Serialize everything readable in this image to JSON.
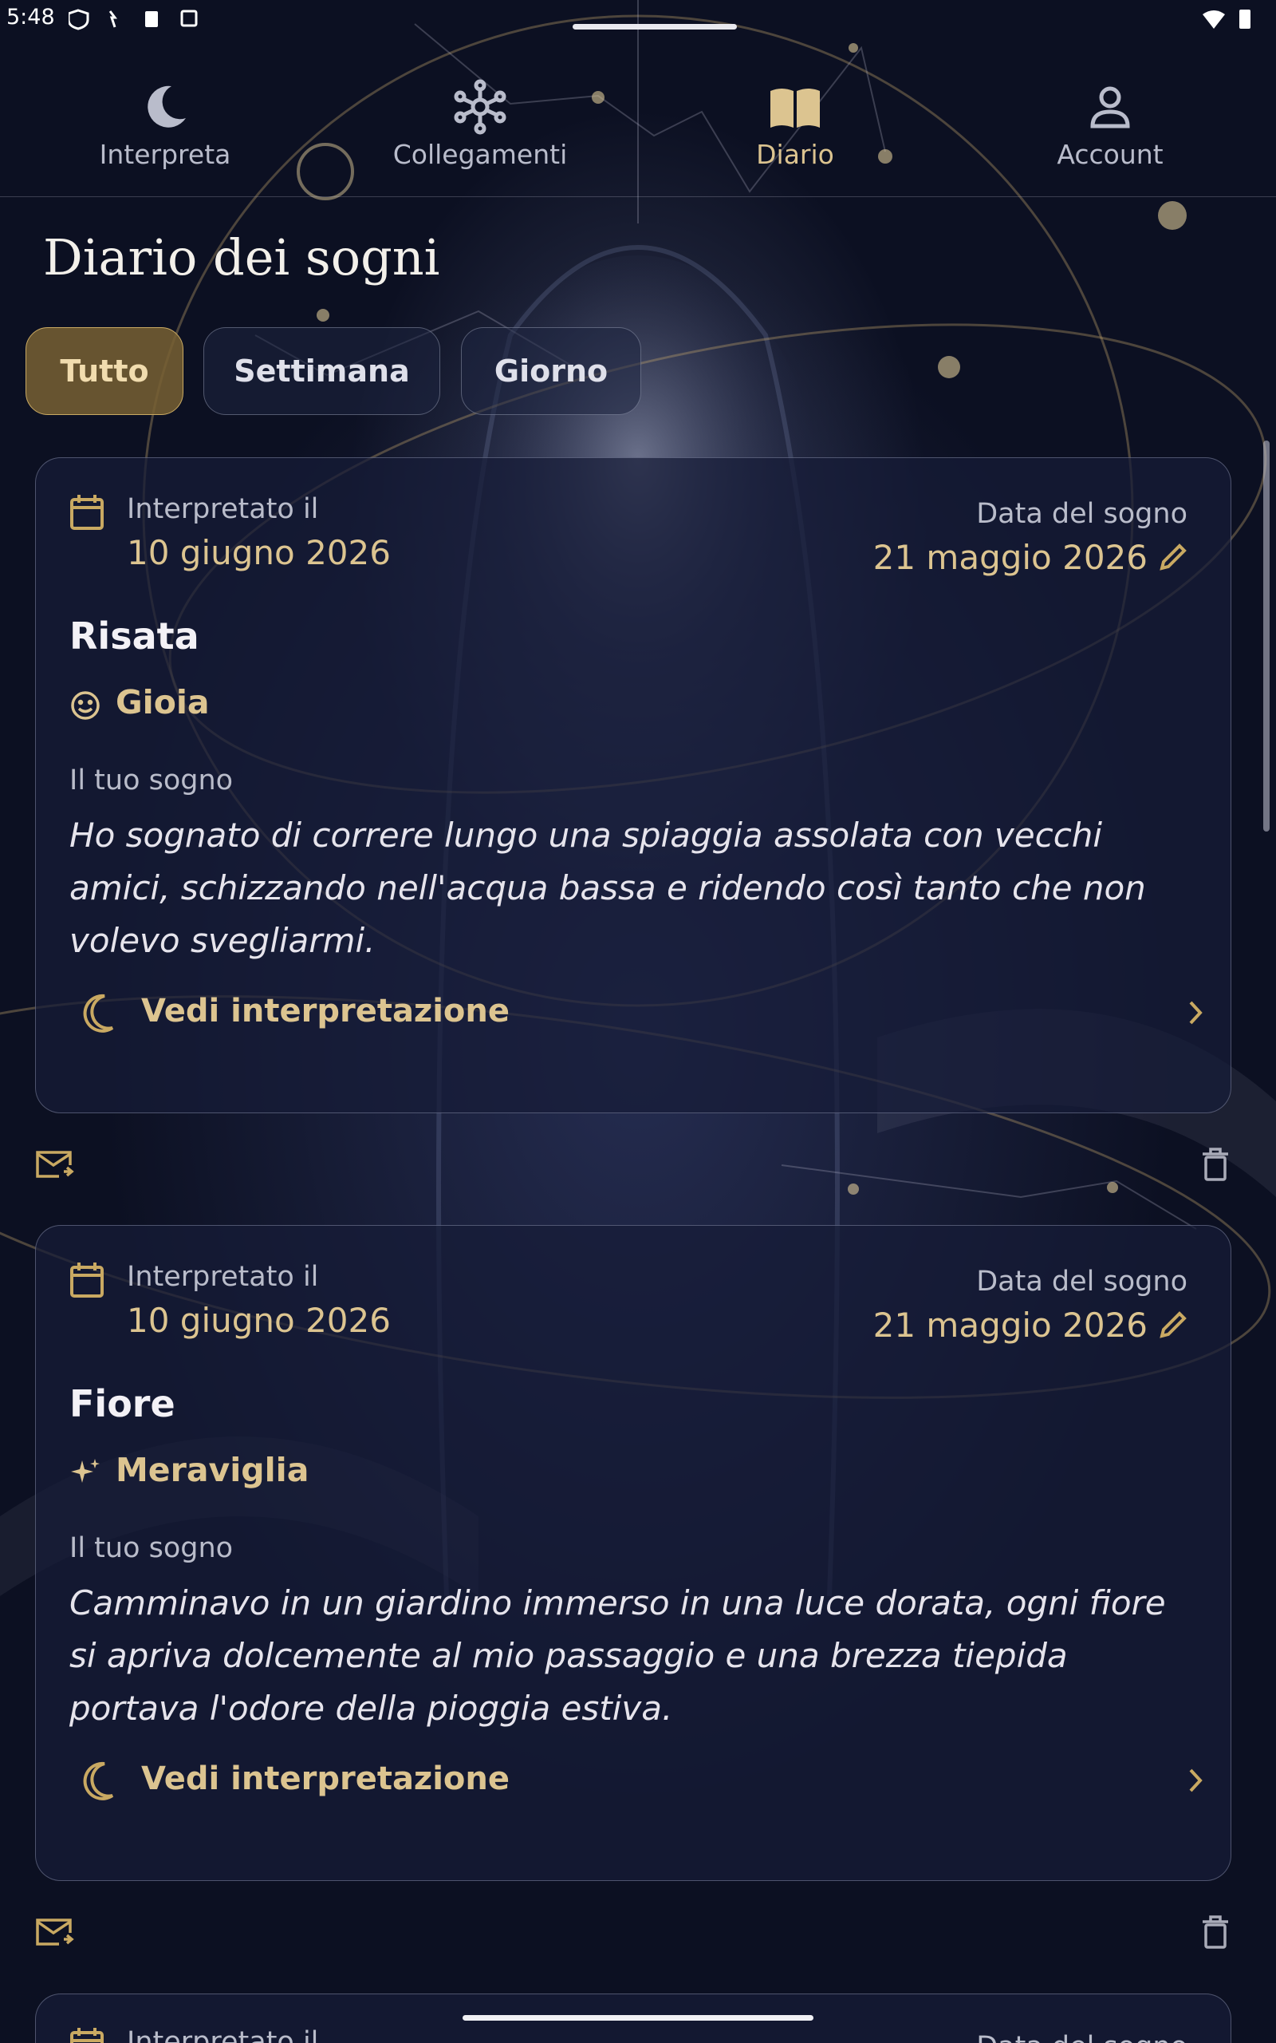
{
  "status_bar": {
    "time": "5:48"
  },
  "nav": {
    "items": [
      {
        "label": "Interpreta",
        "icon": "moon-icon",
        "active": false
      },
      {
        "label": "Collegamenti",
        "icon": "network-icon",
        "active": false
      },
      {
        "label": "Diario",
        "icon": "book-icon",
        "active": true
      },
      {
        "label": "Account",
        "icon": "person-icon",
        "active": false
      }
    ]
  },
  "page": {
    "title": "Diario dei sogni"
  },
  "filters": [
    {
      "label": "Tutto",
      "selected": true
    },
    {
      "label": "Settimana",
      "selected": false
    },
    {
      "label": "Giorno",
      "selected": false
    }
  ],
  "entries": [
    {
      "interpreted_label": "Interpretato il",
      "interpreted_date": "10 giugno 2026",
      "dream_date_label": "Data del sogno",
      "dream_date": "21 maggio 2026",
      "title": "Risata",
      "emotion_icon": "smiley-icon",
      "emotion": "Gioia",
      "dream_label": "Il tuo sogno",
      "dream_text": "Ho sognato di correre lungo una spiaggia assolata con vecchi amici, schizzando nell'acqua bassa e ridendo così tanto che non volevo svegliarmi.",
      "view_label": "Vedi interpretazione"
    },
    {
      "interpreted_label": "Interpretato il",
      "interpreted_date": "10 giugno 2026",
      "dream_date_label": "Data del sogno",
      "dream_date": "21 maggio 2026",
      "title": "Fiore",
      "emotion_icon": "sparkles-icon",
      "emotion": "Meraviglia",
      "dream_label": "Il tuo sogno",
      "dream_text": "Camminavo in un giardino immerso in una luce dorata, ogni fiore si apriva dolcemente al mio passaggio e una brezza tiepida portava l'odore della pioggia estiva.",
      "view_label": "Vedi interpretazione"
    },
    {
      "interpreted_label": "Interpretato il",
      "dream_date_label": "Data del sogno"
    }
  ],
  "colors": {
    "accent": "#dcc490",
    "background": "#0c1022",
    "card": "#161c38"
  }
}
